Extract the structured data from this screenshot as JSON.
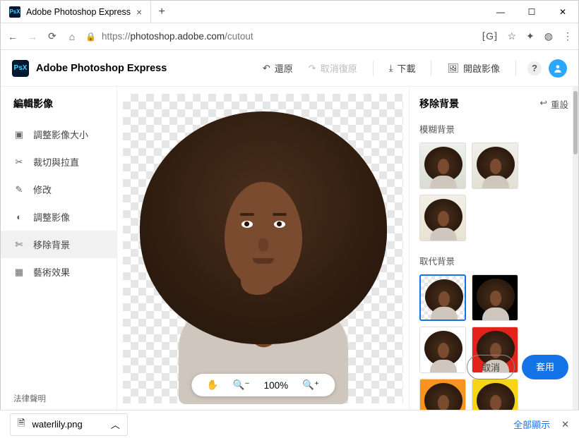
{
  "window": {
    "tab_title": "Adobe Photoshop Express"
  },
  "addressbar": {
    "scheme": "https://",
    "host": "photoshop.adobe.com",
    "path": "/cutout"
  },
  "appbar": {
    "name": "Adobe Photoshop Express",
    "undo": "還原",
    "redo": "取消復原",
    "download": "下載",
    "open": "開啟影像"
  },
  "sidebar": {
    "title": "編輯影像",
    "items": [
      {
        "icon": "resize",
        "label": "調整影像大小"
      },
      {
        "icon": "crop",
        "label": "裁切與拉直"
      },
      {
        "icon": "retouch",
        "label": "修改"
      },
      {
        "icon": "adjust",
        "label": "調整影像"
      },
      {
        "icon": "scissors",
        "label": "移除背景"
      },
      {
        "icon": "art",
        "label": "藝術效果"
      }
    ],
    "legal": "法律聲明"
  },
  "zoom": {
    "level": "100%"
  },
  "panel": {
    "title": "移除背景",
    "reset": "重設",
    "blur_title": "模糊背景",
    "replace_title": "取代背景",
    "cancel": "取消",
    "apply": "套用"
  },
  "downloads": {
    "file": "waterlily.png",
    "show_all": "全部顯示"
  }
}
